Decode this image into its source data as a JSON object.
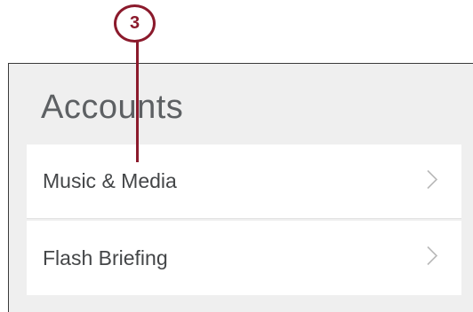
{
  "section": {
    "title": "Accounts"
  },
  "items": [
    {
      "label": "Music & Media",
      "icon": "chevron-right-icon"
    },
    {
      "label": "Flash Briefing",
      "icon": "chevron-right-icon"
    }
  ],
  "callout": {
    "number": "3",
    "color": "#8b1a2c"
  }
}
